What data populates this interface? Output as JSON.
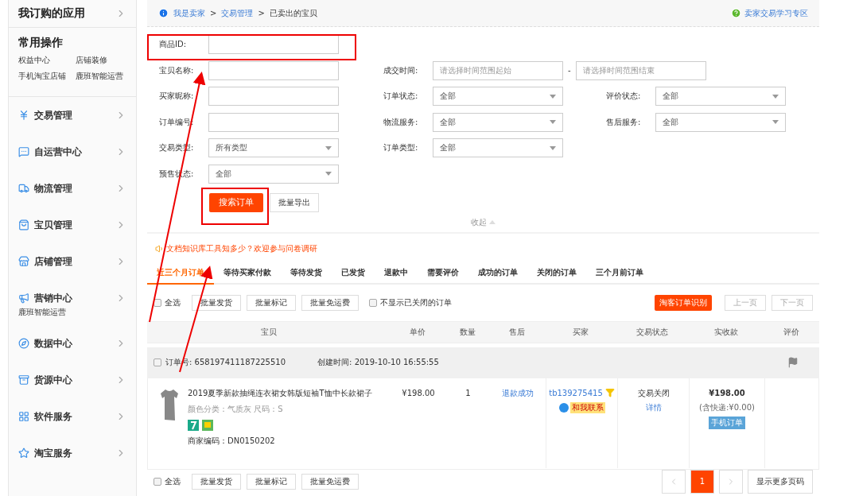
{
  "sidebar": {
    "subscribed": {
      "title": "我订购的应用"
    },
    "common": {
      "title": "常用操作",
      "links": [
        "权益中心",
        "店铺装修",
        "手机淘宝店铺",
        "鹿班智能运营"
      ]
    },
    "items": [
      {
        "label": "交易管理"
      },
      {
        "label": "自运营中心"
      },
      {
        "label": "物流管理"
      },
      {
        "label": "宝贝管理"
      },
      {
        "label": "店铺管理"
      },
      {
        "label": "营销中心",
        "sub": "鹿班智能运营"
      },
      {
        "label": "数据中心"
      },
      {
        "label": "货源中心"
      },
      {
        "label": "软件服务"
      },
      {
        "label": "淘宝服务"
      }
    ]
  },
  "breadcrumb": [
    {
      "label": "我是卖家",
      "link": true
    },
    {
      "label": "交易管理",
      "link": true,
      "separator": ">"
    },
    {
      "label": "已卖出的宝贝",
      "link": false,
      "separator": ">"
    }
  ],
  "help_link": "卖家交易学习专区",
  "form": {
    "rows": [
      [
        {
          "kind": "text",
          "label": "商品ID:"
        }
      ],
      [
        {
          "kind": "text",
          "label": "宝贝名称:"
        },
        {
          "kind": "range",
          "label": "成交时间:",
          "placeholder": "请选择时间范围起始",
          "placeholder_end": "请选择时间范围结束",
          "separator": "-"
        }
      ],
      [
        {
          "kind": "text",
          "label": "买家昵称:"
        },
        {
          "kind": "select",
          "label": "订单状态:",
          "value": "全部"
        },
        {
          "kind": "select",
          "label": "评价状态:",
          "value": "全部"
        }
      ],
      [
        {
          "kind": "text",
          "label": "订单编号:"
        },
        {
          "kind": "select",
          "label": "物流服务:",
          "value": "全部"
        },
        {
          "kind": "select",
          "label": "售后服务:",
          "value": "全部"
        }
      ],
      [
        {
          "kind": "select",
          "label": "交易类型:",
          "value": "所有类型"
        },
        {
          "kind": "select",
          "label": "订单类型:",
          "value": "全部"
        }
      ],
      [
        {
          "kind": "select",
          "label": "预售状态:",
          "value": "全部"
        }
      ]
    ],
    "search_button": "搜索订单",
    "export_button": "批量导出",
    "collapse": "收起"
  },
  "notice": "文档知识库工具知多少？欢迎参与问卷调研",
  "tabs": [
    {
      "label": "近三个月订单",
      "selected": true
    },
    {
      "label": "等待买家付款",
      "selected": false
    },
    {
      "label": "等待发货",
      "selected": false
    },
    {
      "label": "已发货",
      "selected": false
    },
    {
      "label": "退款中",
      "selected": false
    },
    {
      "label": "需要评价",
      "selected": false
    },
    {
      "label": "成功的订单",
      "selected": false
    },
    {
      "label": "关闭的订单",
      "selected": false
    },
    {
      "label": "三个月前订单",
      "selected": false
    }
  ],
  "toolbar": {
    "select_all": {
      "label": "全选",
      "checked": false
    },
    "buttons": [
      "批量发货",
      "批量标记",
      "批量免运费"
    ],
    "hide_closed": {
      "label": "不显示已关闭的订单",
      "checked": false
    },
    "taoke_button": "淘客订单识别",
    "prev_page": "上一页",
    "next_page": "下一页"
  },
  "table": {
    "columns": [
      "宝贝",
      "单价",
      "数量",
      "售后",
      "买家",
      "交易状态",
      "实收款",
      "评价"
    ],
    "orders": [
      {
        "checked": false,
        "order_no": "订单号: 658197411187225510",
        "created": "创建时间: 2019-10-10 16:55:55",
        "item": {
          "title": "2019夏季新款抽绳连衣裙女韩版短袖T恤中长款裙子",
          "attrs": "颜色分类：气质灰  尺码：S",
          "code": "商家编码：DN0150202"
        },
        "price": "¥198.00",
        "quantity": "1",
        "after_sale": "退款成功",
        "buyer": "tb139275415",
        "contact": "和我联系",
        "status": "交易关闭",
        "detail": "详情",
        "total": "¥198.00",
        "shipping": "(含快递:¥0.00)",
        "badge": "手机订单"
      }
    ]
  },
  "bottom_toolbar": {
    "select_all": {
      "label": "全选",
      "checked": false
    },
    "buttons": [
      "批量发货",
      "批量标记",
      "批量免运费"
    ]
  },
  "pagination": {
    "pages": [
      {
        "label": "1",
        "selected": true
      }
    ],
    "more": "显示更多页码"
  }
}
